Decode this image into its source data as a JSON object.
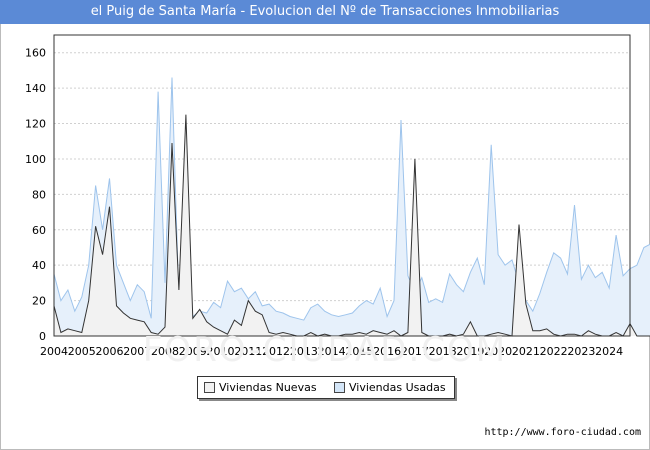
{
  "title": "el Puig de Santa María - Evolucion del Nº de Transacciones Inmobiliarias",
  "source": "http://www.foro-ciudad.com",
  "watermark": "FORO-CIUDAD.COM",
  "colors": {
    "title_bar": "#5b8ad6",
    "nuevas_line": "#333333",
    "nuevas_fill": "#f2f2f2",
    "usadas_line": "#9ec4ec",
    "usadas_fill": "#e6f0fb",
    "grid": "#d0d0d0"
  },
  "legend": {
    "items": [
      {
        "label": "Viviendas Nuevas",
        "swatch": "#f2f2f2"
      },
      {
        "label": "Viviendas Usadas",
        "swatch": "#d4e6f8"
      }
    ],
    "position": "bottom-center"
  },
  "chart_data": {
    "type": "area",
    "x_labels": [
      "2004",
      "2005",
      "2006",
      "2007",
      "2008",
      "2009",
      "2010",
      "2011",
      "2012",
      "2013",
      "2014",
      "2015",
      "2016",
      "2017",
      "2018",
      "2019",
      "2020",
      "2021",
      "2022",
      "2023",
      "2024"
    ],
    "x_start": 2004.0,
    "x_step": 0.25,
    "xlim": [
      2004,
      2024.75
    ],
    "ylim": [
      0,
      170
    ],
    "y_ticks": [
      0,
      20,
      40,
      60,
      80,
      100,
      120,
      140,
      160
    ],
    "grid": "horizontal",
    "series": [
      {
        "name": "Viviendas Nuevas",
        "values": [
          17,
          2,
          4,
          3,
          2,
          20,
          62,
          46,
          73,
          17,
          13,
          10,
          9,
          8,
          2,
          1,
          5,
          109,
          26,
          125,
          10,
          15,
          8,
          5,
          3,
          1,
          9,
          6,
          20,
          14,
          12,
          2,
          1,
          2,
          1,
          0,
          0,
          2,
          0,
          1,
          0,
          0,
          1,
          1,
          2,
          1,
          3,
          2,
          1,
          3,
          0,
          2,
          100,
          2,
          0,
          0,
          0,
          1,
          0,
          1,
          8,
          0,
          0,
          1,
          2,
          1,
          0,
          63,
          18,
          3,
          3,
          4,
          1,
          0,
          1,
          1,
          0,
          3,
          1,
          0,
          0,
          2,
          0,
          7,
          0,
          0,
          0,
          2,
          5,
          4,
          1,
          0,
          5,
          14
        ]
      },
      {
        "name": "Viviendas Usadas",
        "values": [
          35,
          20,
          26,
          14,
          22,
          40,
          85,
          60,
          89,
          40,
          30,
          20,
          29,
          25,
          10,
          138,
          30,
          146,
          20,
          31,
          11,
          14,
          13,
          19,
          16,
          31,
          25,
          27,
          21,
          25,
          17,
          18,
          14,
          13,
          11,
          10,
          9,
          16,
          18,
          14,
          12,
          11,
          12,
          13,
          17,
          20,
          18,
          27,
          11,
          20,
          122,
          34,
          25,
          33,
          19,
          21,
          19,
          35,
          29,
          25,
          36,
          44,
          29,
          108,
          46,
          40,
          43,
          30,
          20,
          14,
          24,
          36,
          47,
          44,
          35,
          74,
          32,
          40,
          33,
          36,
          27,
          57,
          34,
          38,
          40,
          50,
          52
        ]
      }
    ]
  }
}
